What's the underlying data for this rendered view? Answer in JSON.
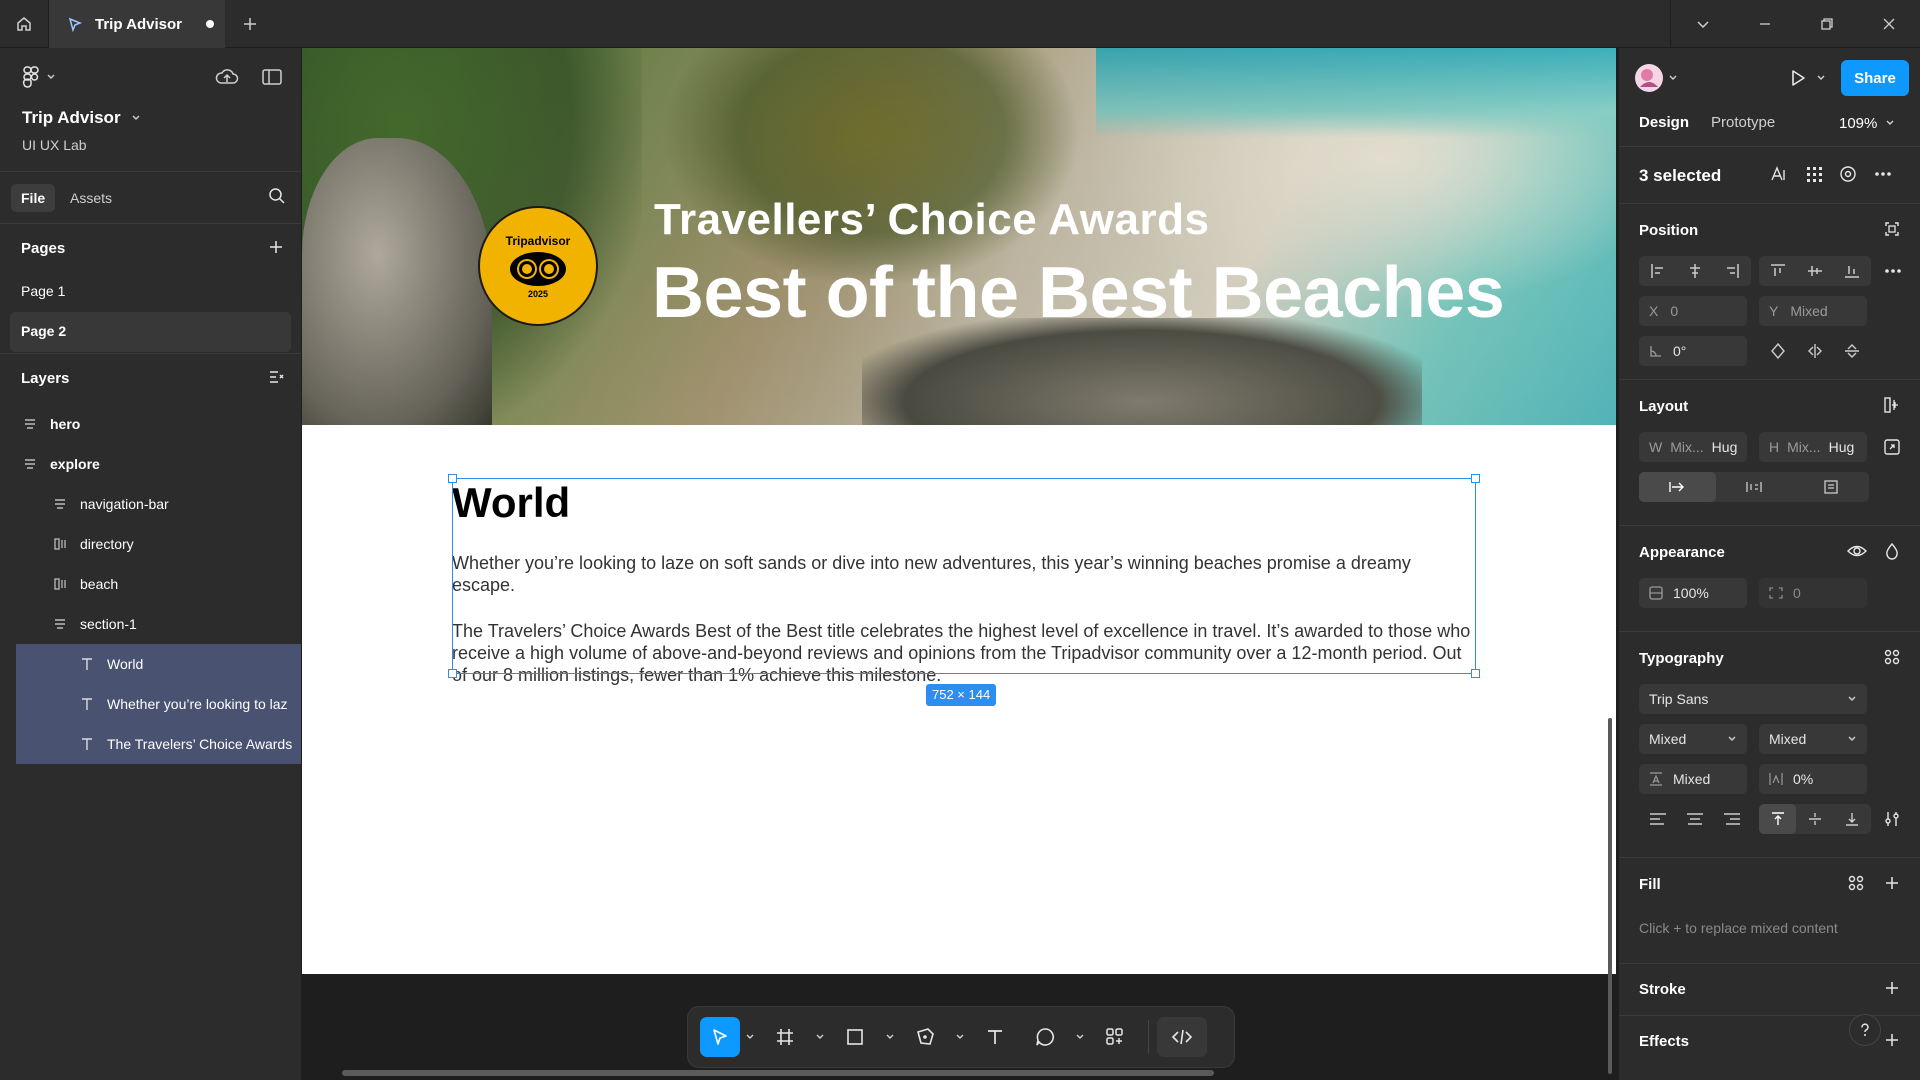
{
  "tab": {
    "title": "Trip Advisor"
  },
  "file": {
    "name": "Trip Advisor",
    "team": "UI UX Lab"
  },
  "left_tabs": [
    "File",
    "Assets"
  ],
  "pages": {
    "heading": "Pages",
    "items": [
      "Page 1",
      "Page 2"
    ],
    "active": "Page 2"
  },
  "layers": {
    "heading": "Layers",
    "items": [
      {
        "label": "hero",
        "kind": "frame"
      },
      {
        "label": "explore",
        "kind": "frame"
      },
      {
        "label": "navigation-bar",
        "kind": "frame"
      },
      {
        "label": "directory",
        "kind": "autolayout"
      },
      {
        "label": "beach",
        "kind": "autolayout"
      },
      {
        "label": "section-1",
        "kind": "frame"
      },
      {
        "label": "World",
        "kind": "text"
      },
      {
        "label": "Whether you’re looking to laz",
        "kind": "text"
      },
      {
        "label": "The Travelers’ Choice Awards",
        "kind": "text"
      }
    ]
  },
  "canvas": {
    "badge": {
      "top": "Tripadvisor",
      "year": "2025"
    },
    "hero_sub": "Travellers’ Choice Awards",
    "hero_title": "Best of the Best Beaches",
    "section_title": "World",
    "p1": "Whether you’re looking to laze on soft sands or dive into new adventures, this year’s winning beaches promise a dreamy escape.",
    "p2": "The Travelers’ Choice Awards Best of the Best title celebrates the highest level of excellence in travel. It’s awarded to those who receive a high volume of above-and-beyond reviews and opinions from the Tripadvisor community over a 12-month period. Out of our 8 million listings, fewer than 1% achieve this milestone.",
    "size_label": "752 × 144"
  },
  "right": {
    "share": "Share",
    "tabs": [
      "Design",
      "Prototype"
    ],
    "zoom": "109%",
    "selected": "3 selected",
    "position": {
      "heading": "Position",
      "x_key": "X",
      "x": "0",
      "y_key": "Y",
      "y": "Mixed",
      "rotation": "0°"
    },
    "layout": {
      "heading": "Layout",
      "w_key": "W",
      "w": "Mix...",
      "w_mode": "Hug",
      "h_key": "H",
      "h": "Mix...",
      "h_mode": "Hug"
    },
    "appearance": {
      "heading": "Appearance",
      "opacity": "100%",
      "radius": "0"
    },
    "typography": {
      "heading": "Typography",
      "font": "Trip Sans",
      "weight": "Mixed",
      "size": "Mixed",
      "line_height": "Mixed",
      "letter_spacing": "0%"
    },
    "fill": {
      "heading": "Fill",
      "note": "Click + to replace mixed content"
    },
    "stroke": {
      "heading": "Stroke"
    },
    "effects": {
      "heading": "Effects"
    }
  },
  "colors": {
    "accent": "#0d99ff",
    "selection": "#2d8ef0",
    "badge": "#f2b200",
    "panel": "#2c2c2c"
  }
}
